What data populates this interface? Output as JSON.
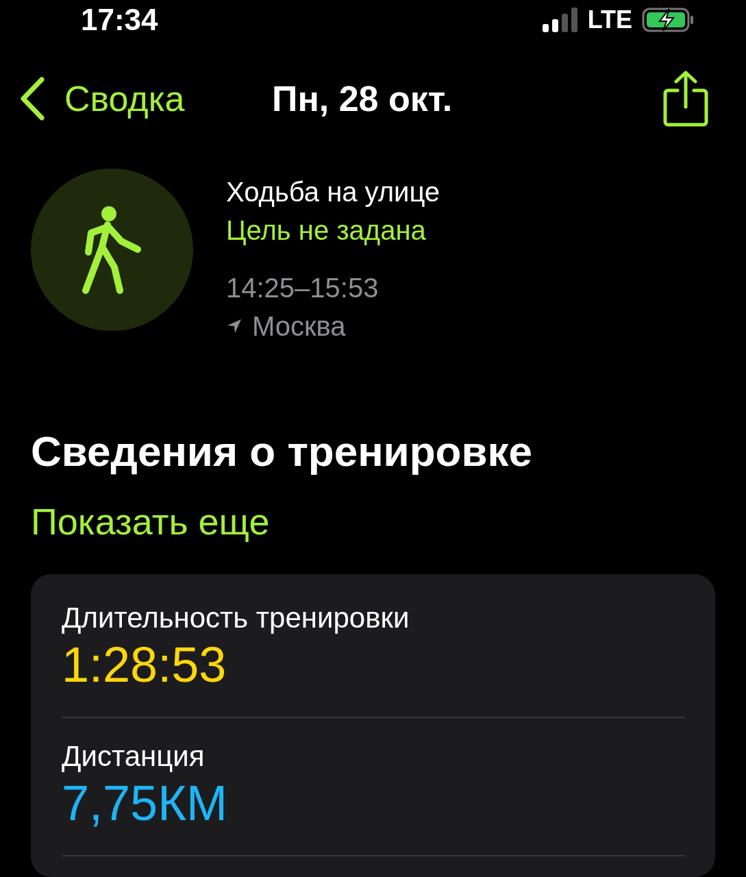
{
  "status_bar": {
    "time": "17:34",
    "network": "LTE",
    "charging": true
  },
  "nav": {
    "back": "Сводка",
    "title": "Пн, 28 окт."
  },
  "workout": {
    "name": "Ходьба на улице",
    "goal": "Цель не задана",
    "time_range": "14:25–15:53",
    "location": "Москва"
  },
  "section": {
    "title": "Сведения о тренировке",
    "more": "Показать еще"
  },
  "metrics": [
    {
      "label": "Длительность тренировки",
      "value": "1:28:53",
      "color": "#ffd60a"
    },
    {
      "label": "Дистанция",
      "value": "7,75КМ",
      "color": "#1eb5f5"
    }
  ]
}
